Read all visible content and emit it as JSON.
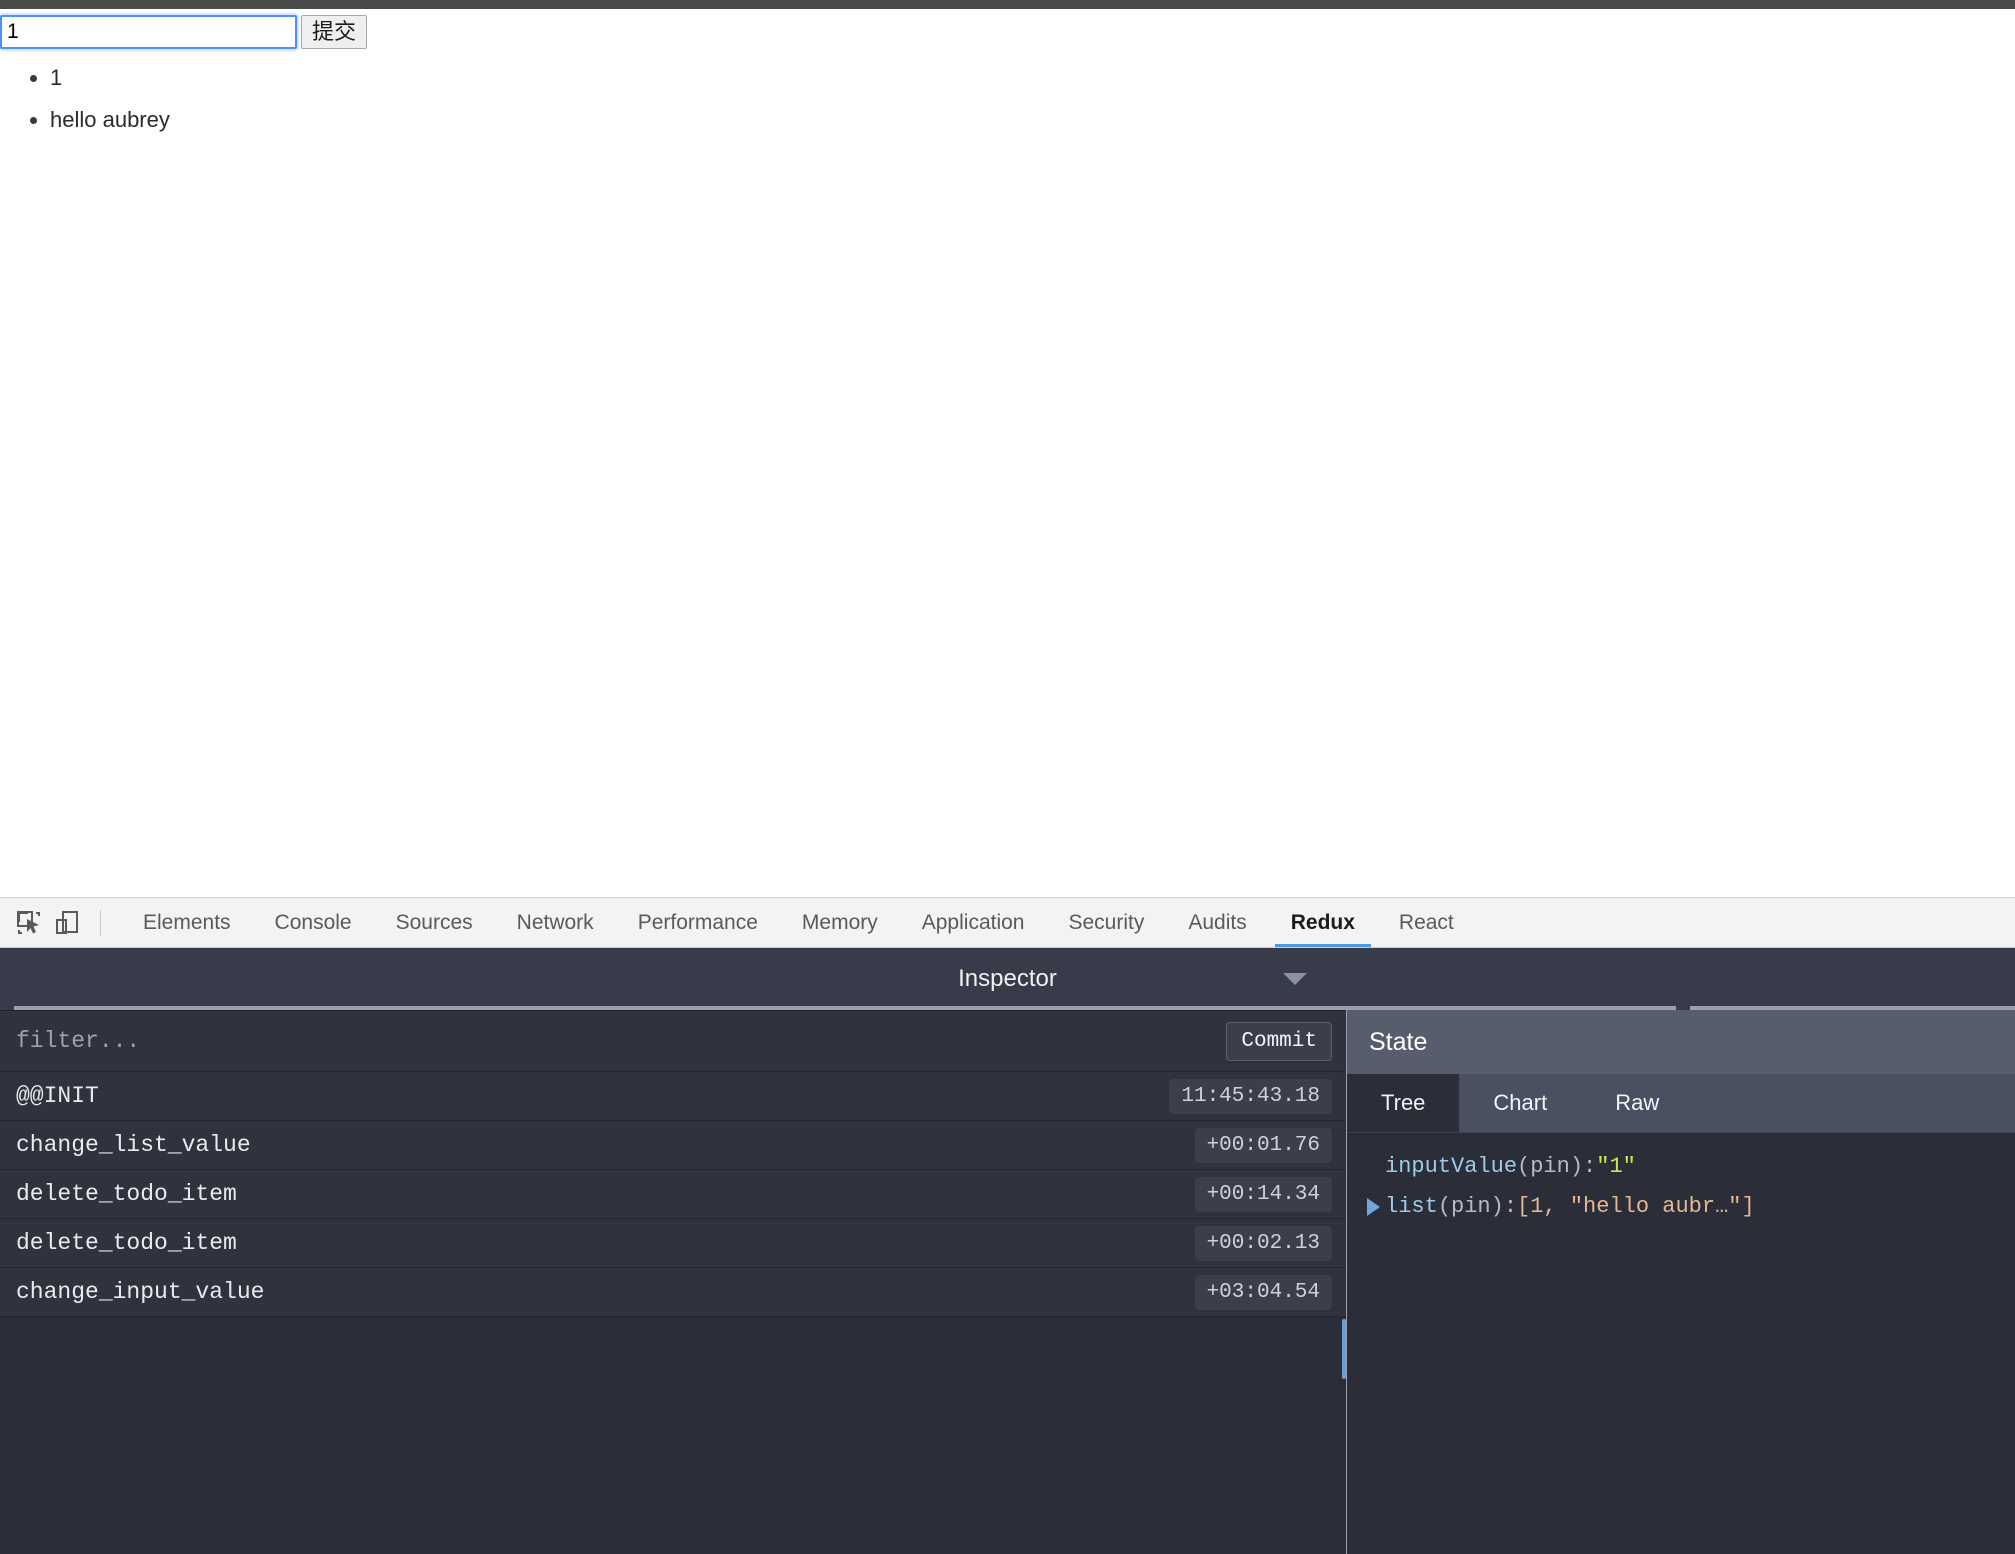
{
  "page": {
    "input": {
      "value": "1",
      "placeholder": ""
    },
    "submit_label": "提交",
    "todos": [
      "1",
      "hello aubrey"
    ]
  },
  "devtools": {
    "icons": [
      {
        "name": "inspect-element-icon"
      },
      {
        "name": "device-toolbar-icon"
      }
    ],
    "tabs": [
      {
        "label": "Elements",
        "active": false
      },
      {
        "label": "Console",
        "active": false
      },
      {
        "label": "Sources",
        "active": false
      },
      {
        "label": "Network",
        "active": false
      },
      {
        "label": "Performance",
        "active": false
      },
      {
        "label": "Memory",
        "active": false
      },
      {
        "label": "Application",
        "active": false
      },
      {
        "label": "Security",
        "active": false
      },
      {
        "label": "Audits",
        "active": false
      },
      {
        "label": "Redux",
        "active": true
      },
      {
        "label": "React",
        "active": false
      }
    ],
    "accent_color": "#4a9ae0"
  },
  "redux": {
    "inspector_title": "Inspector",
    "filter": {
      "value": "",
      "placeholder": "filter..."
    },
    "commit_label": "Commit",
    "actions": [
      {
        "name": "@@INIT",
        "time": "11:45:43.18"
      },
      {
        "name": "change_list_value",
        "time": "+00:01.76"
      },
      {
        "name": "delete_todo_item",
        "time": "+00:14.34"
      },
      {
        "name": "delete_todo_item",
        "time": "+00:02.13"
      },
      {
        "name": "change_input_value",
        "time": "+03:04.54"
      }
    ],
    "state": {
      "title": "State",
      "tabs": [
        {
          "label": "Tree",
          "active": true
        },
        {
          "label": "Chart",
          "active": false
        },
        {
          "label": "Raw",
          "active": false
        }
      ],
      "tree": [
        {
          "key": "inputValue",
          "meta": " (pin): ",
          "value": "\"1\"",
          "value_kind": "string",
          "expandable": false
        },
        {
          "key": "list",
          "meta": " (pin): ",
          "value": "[1, \"hello aubr…\"]",
          "value_kind": "array",
          "expandable": true
        }
      ]
    }
  }
}
